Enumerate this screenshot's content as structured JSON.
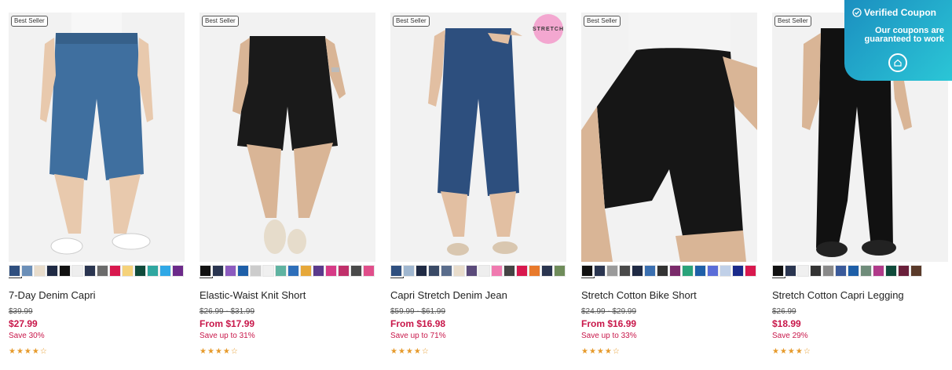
{
  "products": [
    {
      "badge": "Best Seller",
      "name": "7-Day Denim Capri",
      "orig_price": "$39.99",
      "price": "$27.99",
      "save": "Save 30%",
      "rating": "★★★★☆",
      "swatches": [
        "#2f4f7f",
        "#6b8fb8",
        "#e8dccb",
        "#1f2a44",
        "#111111",
        "#eeeeee",
        "#2a3550",
        "#6b6b6b",
        "#d8184e",
        "#f5d27a",
        "#0f4a3a",
        "#2fa7a0",
        "#30a8e6",
        "#6c2a8a",
        "#7b1f4a"
      ]
    },
    {
      "badge": "Best Seller",
      "name": "Elastic-Waist Knit Short",
      "orig_price": "$26.99 - $31.99",
      "price": "From $17.99",
      "save": "Save up to 31%",
      "rating": "★★★★☆",
      "swatches": [
        "#111111",
        "#2a3550",
        "#8c5bbf",
        "#1e5fa8",
        "#cccccc",
        "#f0f0f0",
        "#5fb3a1",
        "#2e6fba",
        "#e6a83a",
        "#5a3a8c",
        "#d63a86",
        "#c0306a",
        "#4a4a4a",
        "#e04e8a",
        "#f2d93a",
        "#a44ad1",
        "#3dbf8a",
        "#c9df49"
      ]
    },
    {
      "badge": "Best Seller",
      "name": "Capri Stretch Denim Jean",
      "orig_price": "$59.99 - $61.99",
      "price": "From $16.98",
      "save": "Save up to 71%",
      "rating": "★★★★☆",
      "stretch": "STRETCH",
      "swatches": [
        "#2f4f7f",
        "#9fb6cf",
        "#1f2a44",
        "#3a4a66",
        "#5a6d8c",
        "#e8dccb",
        "#5a4a7a",
        "#eeeeee",
        "#f07ab0",
        "#444444",
        "#d8184e",
        "#e87a2c",
        "#2a3550",
        "#6f8c5a",
        "#b04a6a",
        "#3a1f3a",
        "#7a3ab0",
        "#c0c0c0"
      ]
    },
    {
      "badge": "Best Seller",
      "name": "Stretch Cotton Bike Short",
      "orig_price": "$24.99 - $29.99",
      "price": "From $16.99",
      "save": "Save up to 33%",
      "rating": "★★★★☆",
      "swatches": [
        "#111111",
        "#2a3550",
        "#9a9a9a",
        "#4a4a4a",
        "#1f2a44",
        "#3a6fb0",
        "#333333",
        "#7a2a6a",
        "#2aa37a",
        "#1e5fa8",
        "#5a6dd8",
        "#c0d0e8",
        "#1a2a8a",
        "#d8184e",
        "#f5f5f5"
      ]
    },
    {
      "badge": "Best Seller",
      "name": "Stretch Cotton Capri Legging",
      "orig_price": "$26.99",
      "price": "$18.99",
      "save": "Save 29%",
      "rating": "★★★★☆",
      "swatches": [
        "#111111",
        "#2a3550",
        "#f0f0f0",
        "#333333",
        "#8a8a8a",
        "#3a5a9a",
        "#1e5fa8",
        "#6f8c7a",
        "#b03a8a",
        "#0f4a3a",
        "#6a1f3a",
        "#5a3a2a"
      ]
    }
  ],
  "coupon": {
    "title": "Verified Coupon",
    "subtitle": "Our coupons are guaranteed to work",
    "check_icon": "check-circle-icon",
    "logo_icon": "shop-logo-icon"
  },
  "colors": {
    "sale_red": "#c8174a",
    "star_orange": "#e69a2b",
    "coupon_gradient_start": "#1b8fc0",
    "coupon_gradient_end": "#2bc6d6"
  }
}
